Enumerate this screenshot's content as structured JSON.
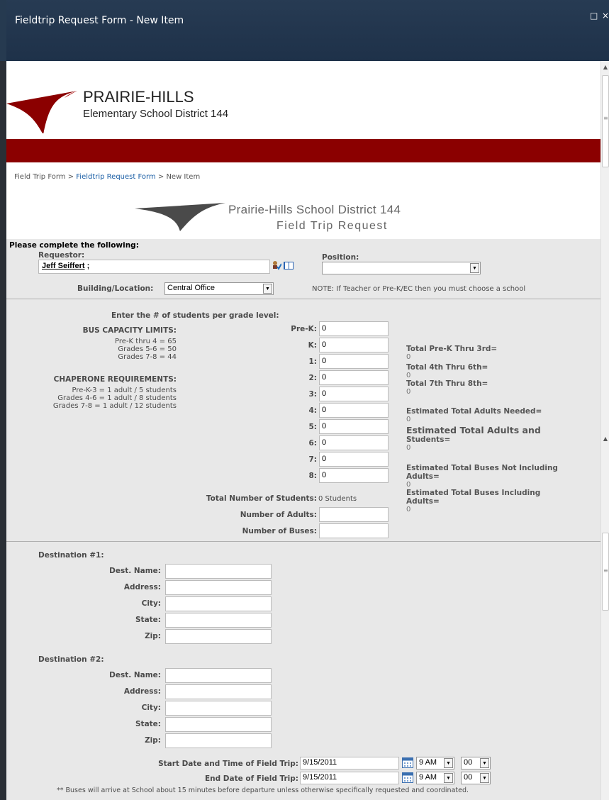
{
  "window": {
    "title": "Fieldtrip Request Form - New Item",
    "restore_icon": "□",
    "close_icon": "×"
  },
  "scrollbar": {
    "up_icon": "▲",
    "down_icon": "▲",
    "grip_icon": "≡"
  },
  "header": {
    "name": "PRAIRIE-HILLS",
    "subtitle": "Elementary School District 144"
  },
  "breadcrumb": {
    "item1": "Field Trip Form",
    "sep1": " > ",
    "item2": "Fieldtrip Request Form",
    "sep2": " > ",
    "item3": "New Item"
  },
  "banner": {
    "line1": "Prairie-Hills School District 144",
    "line2": "Field Trip Request"
  },
  "form": {
    "intro": "Please complete the following:",
    "requestor_label": "Requestor:",
    "requestor_value": "Jeff Seiffert",
    "requestor_suffix": " ;",
    "check_names_icon": "check-names",
    "browse_icon": "address-book",
    "position_label": "Position:",
    "position_value": "",
    "building_label": "Building/Location:",
    "building_value": "Central Office",
    "note": "NOTE: If Teacher or Pre-K/EC then you must choose a school",
    "students_heading": "Enter the # of students per grade level:",
    "bus_heading": "BUS CAPACITY LIMITS:",
    "bus_lines": [
      "Pre-K thru 4 = 65",
      "Grades 5-6 = 50",
      "Grades 7-8 = 44"
    ],
    "chap_heading": "CHAPERONE REQUIREMENTS:",
    "chap_lines": [
      "Pre-K-3 = 1 adult / 5 students",
      "Grades 4-6 = 1 adult / 8 students",
      "Grades 7-8 = 1 adult / 12 students"
    ],
    "grades": [
      {
        "label": "Pre-K:",
        "value": "0"
      },
      {
        "label": "K:",
        "value": "0"
      },
      {
        "label": "1:",
        "value": "0"
      },
      {
        "label": "2:",
        "value": "0"
      },
      {
        "label": "3:",
        "value": "0"
      },
      {
        "label": "4:",
        "value": "0"
      },
      {
        "label": "5:",
        "value": "0"
      },
      {
        "label": "6:",
        "value": "0"
      },
      {
        "label": "7:",
        "value": "0"
      },
      {
        "label": "8:",
        "value": "0"
      }
    ],
    "totals": [
      {
        "label": "Total Pre-K Thru 3rd=",
        "value": "0"
      },
      {
        "label": "Total 4th Thru 6th=",
        "value": "0"
      },
      {
        "label": "Total 7th Thru 8th=",
        "value": "0"
      }
    ],
    "adults_needed_label": "Estimated Total Adults Needed=",
    "adults_needed_value": "0",
    "adults_students_label1": "Estimated Total Adults and",
    "adults_students_label2": "Students=",
    "adults_students_value": "0",
    "buses_not_label1": "Estimated Total Buses Not Including",
    "buses_not_label2": "Adults=",
    "buses_not_value": "0",
    "buses_inc_label1": "Estimated Total Buses Including",
    "buses_inc_label2": "Adults=",
    "buses_inc_value": "0",
    "total_students_label": "Total Number of Students:",
    "total_students_value": "0 Students",
    "num_adults_label": "Number of Adults:",
    "num_adults_value": "",
    "num_buses_label": "Number of Buses:",
    "num_buses_value": "",
    "dest1_heading": "Destination #1:",
    "dest2_heading": "Destination #2:",
    "dest_labels": [
      "Dest. Name:",
      "Address:",
      "City:",
      "State:",
      "Zip:"
    ],
    "start_label": "Start Date and Time of Field Trip:",
    "start_date": "9/15/2011",
    "start_hour": "9 AM",
    "start_min": "00",
    "end_label": "End Date of Field Trip:",
    "end_date": "9/15/2011",
    "end_hour": "9 AM",
    "end_min": "00",
    "bus_note": "** Buses will arrive at School about 15 minutes before departure unless otherwise specifically requested and coordinated."
  },
  "colors": {
    "titlebar": "#1e3149",
    "brand_red": "#8b0000",
    "form_bg": "#e8e8e8",
    "link": "#1a5ea5"
  }
}
